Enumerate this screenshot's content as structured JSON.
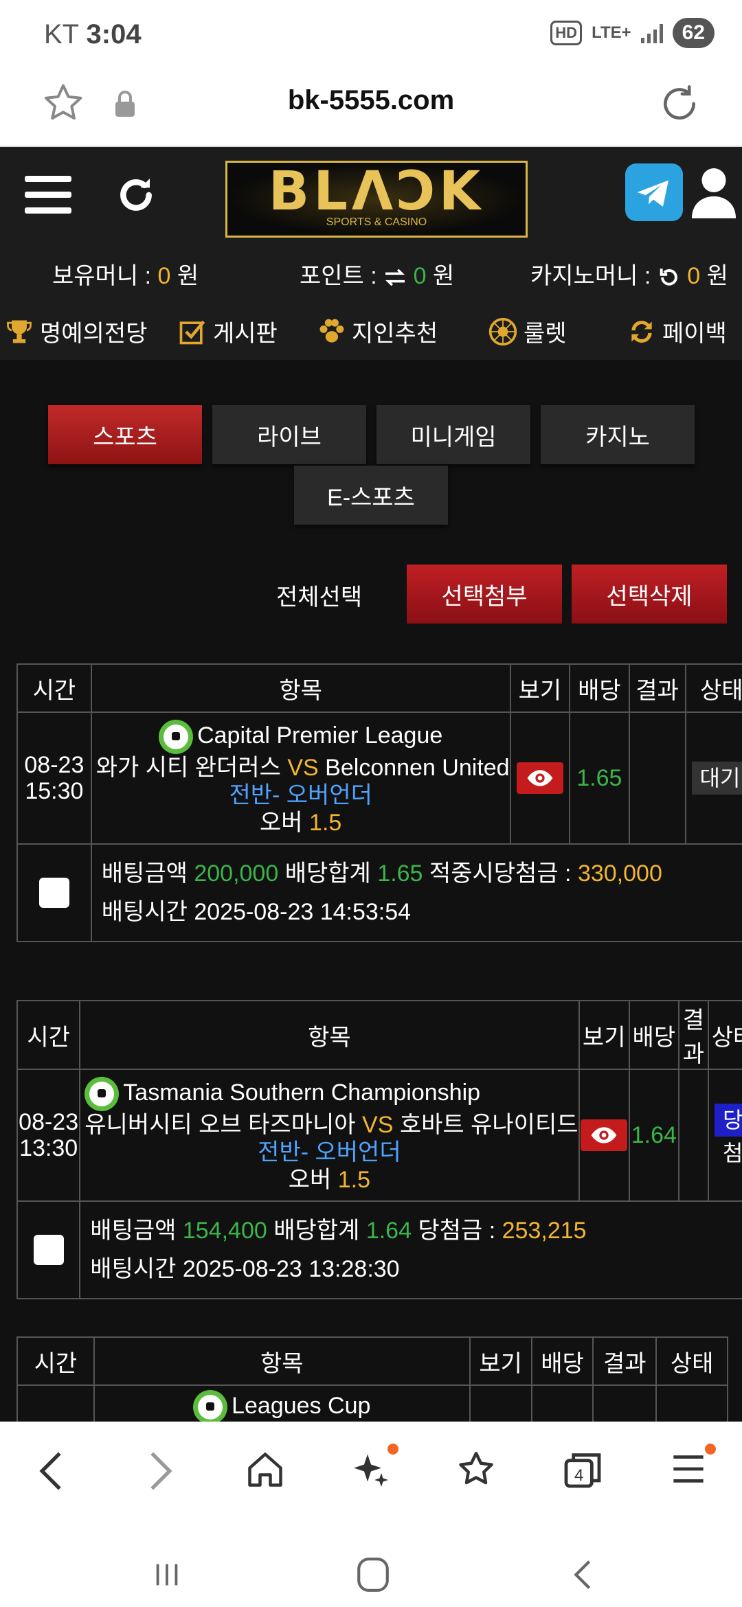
{
  "status_bar": {
    "carrier": "KT",
    "time": "3:04",
    "hd": "HD",
    "lte": "LTE+",
    "battery": "62"
  },
  "browser": {
    "url": "bk-5555.com",
    "tabs_count": "4"
  },
  "header": {
    "logo_text": "BLΛϽK",
    "logo_sub": "SPORTS & CASINO",
    "balances": {
      "money_label": "보유머니 :",
      "money_value": "0",
      "money_unit": "원",
      "point_label": "포인트 :",
      "point_value": "0",
      "point_unit": "원",
      "casino_label": "카지노머니 :",
      "casino_value": "0",
      "casino_unit": "원"
    },
    "nav": [
      "명예의전당",
      "게시판",
      "지인추천",
      "룰렛",
      "페이백"
    ]
  },
  "categories": [
    "스포츠",
    "라이브",
    "미니게임",
    "카지노",
    "E-스포츠"
  ],
  "actions": {
    "select_all": "전체선택",
    "attach": "선택첨부",
    "delete": "선택삭제"
  },
  "table_headers": [
    "시간",
    "항목",
    "보기",
    "배당",
    "결과",
    "상태"
  ],
  "bets": [
    {
      "date": "08-23",
      "time": "15:30",
      "league": "Capital Premier League",
      "home": "와가 시티 완더러스",
      "vs": "VS",
      "away": "Belconnen United",
      "market": "전반- 오버언더",
      "pick": "오버",
      "line": "1.5",
      "odds": "1.65",
      "result": "",
      "status": "대기",
      "amount_label": "배팅금액",
      "amount": "200,000",
      "total_label": "배당합계",
      "total": "1.65",
      "payout_label": "적중시당첨금 :",
      "payout": "330,000",
      "bettime_label": "배팅시간",
      "bettime": "2025-08-23 14:53:54"
    },
    {
      "date": "08-23",
      "time": "13:30",
      "league": "Tasmania Southern Championship",
      "home": "유니버시티 오브 타즈마니아",
      "vs": "VS",
      "away": "호바트 유나이티드",
      "market": "전반- 오버언더",
      "pick": "오버",
      "line": "1.5",
      "odds": "1.64",
      "result": "",
      "status": "당첨",
      "amount_label": "배팅금액",
      "amount": "154,400",
      "total_label": "배당합계",
      "total": "1.64",
      "payout_label": "당첨금 :",
      "payout": "253,215",
      "bettime_label": "배팅시간",
      "bettime": "2025-08-23 13:28:30"
    },
    {
      "league": "Leagues Cup"
    }
  ],
  "colors": {
    "accent_red": "#c01f24",
    "gold": "#f2b630",
    "green": "#3bb54a",
    "blue": "#4fa3ff",
    "win_blue": "#1f1fc8"
  }
}
